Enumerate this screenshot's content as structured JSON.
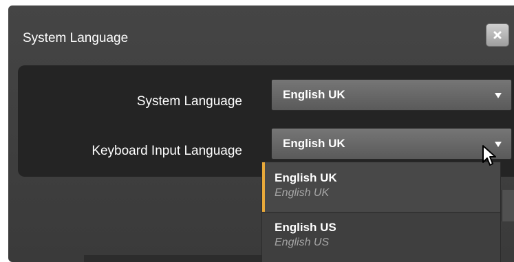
{
  "dialog": {
    "title": "System Language",
    "close_icon": "close-icon"
  },
  "form": {
    "system_language": {
      "label": "System Language",
      "value": "English UK"
    },
    "keyboard_language": {
      "label": "Keyboard Input Language",
      "value": "English UK"
    }
  },
  "dropdown": {
    "options": [
      {
        "label": "English UK",
        "native": "English UK",
        "selected": true
      },
      {
        "label": "English US",
        "native": "English US",
        "selected": false
      }
    ]
  },
  "colors": {
    "accent": "#e8a93a",
    "dialog_bg": "#404040",
    "panel_bg": "#242424"
  }
}
